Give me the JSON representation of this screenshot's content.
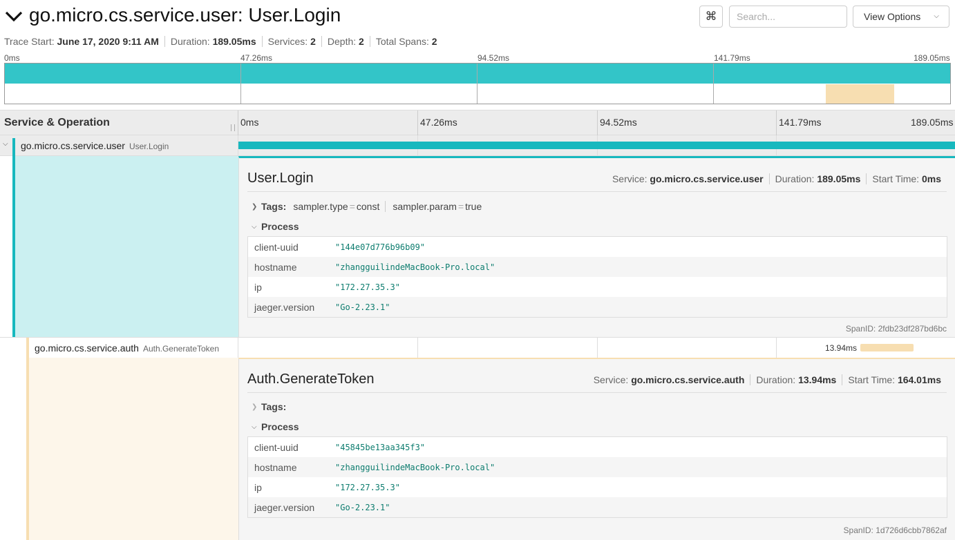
{
  "header": {
    "title": "go.micro.cs.service.user: User.Login",
    "kbd_symbol": "⌘",
    "search_placeholder": "Search...",
    "view_options_label": "View Options"
  },
  "meta": {
    "trace_start_label": "Trace Start:",
    "trace_start": "June 17, 2020 9:11 AM",
    "duration_label": "Duration:",
    "duration": "189.05ms",
    "services_label": "Services:",
    "services": "2",
    "depth_label": "Depth:",
    "depth": "2",
    "total_spans_label": "Total Spans:",
    "total_spans": "2"
  },
  "ticks": [
    "0ms",
    "47.26ms",
    "94.52ms",
    "141.79ms",
    "189.05ms"
  ],
  "timeline": {
    "column_header": "Service & Operation"
  },
  "spans": [
    {
      "service": "go.micro.cs.service.user",
      "operation": "User.Login",
      "color": "#17b8be",
      "duration_label": "",
      "detail": {
        "title": "User.Login",
        "service_label": "Service:",
        "service": "go.micro.cs.service.user",
        "duration_label": "Duration:",
        "duration": "189.05ms",
        "start_label": "Start Time:",
        "start": "0ms",
        "tags_label": "Tags:",
        "tags": [
          {
            "key": "sampler.type",
            "value": "const"
          },
          {
            "key": "sampler.param",
            "value": "true"
          }
        ],
        "process_label": "Process",
        "process": [
          {
            "key": "client-uuid",
            "value": "\"144e07d776b96b09\""
          },
          {
            "key": "hostname",
            "value": "\"zhangguilindeMacBook-Pro.local\""
          },
          {
            "key": "ip",
            "value": "\"172.27.35.3\""
          },
          {
            "key": "jaeger.version",
            "value": "\"Go-2.23.1\""
          }
        ],
        "spanid_label": "SpanID:",
        "spanid": "2fdb23df287bd6bc"
      }
    },
    {
      "service": "go.micro.cs.service.auth",
      "operation": "Auth.GenerateToken",
      "color": "#f7deb1",
      "duration_label": "13.94ms",
      "detail": {
        "title": "Auth.GenerateToken",
        "service_label": "Service:",
        "service": "go.micro.cs.service.auth",
        "duration_label": "Duration:",
        "duration": "13.94ms",
        "start_label": "Start Time:",
        "start": "164.01ms",
        "tags_label": "Tags:",
        "process_label": "Process",
        "process": [
          {
            "key": "client-uuid",
            "value": "\"45845be13aa345f3\""
          },
          {
            "key": "hostname",
            "value": "\"zhangguilindeMacBook-Pro.local\""
          },
          {
            "key": "ip",
            "value": "\"172.27.35.3\""
          },
          {
            "key": "jaeger.version",
            "value": "\"Go-2.23.1\""
          }
        ],
        "spanid_label": "SpanID:",
        "spanid": "1d726d6cbb7862af"
      }
    }
  ]
}
